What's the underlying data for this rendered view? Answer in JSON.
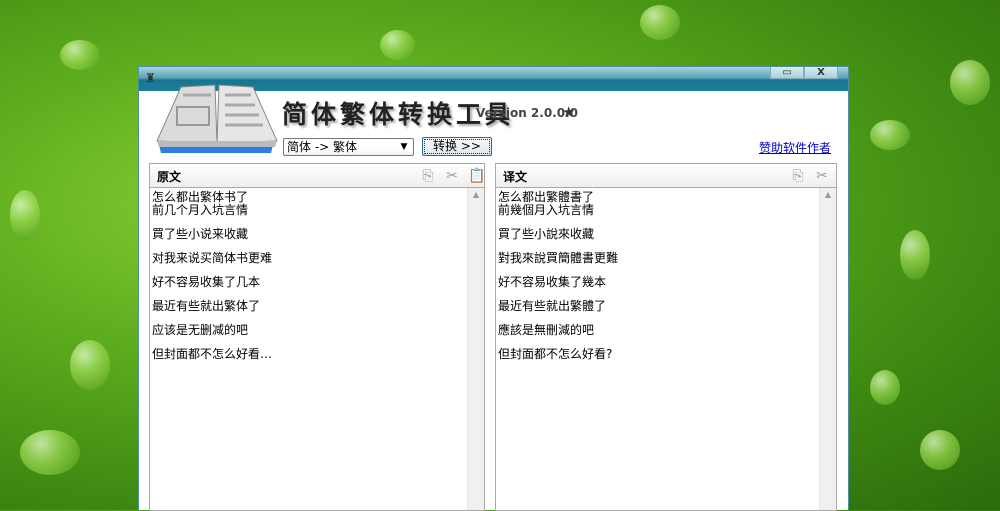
{
  "window": {
    "app_title": "简体繁体转换工具",
    "version": "Version 2.0.0.0",
    "minimize": "▭",
    "close": "X"
  },
  "toolbar": {
    "direction_selected": "简体 -> 繁体",
    "convert_label": "转换 >>",
    "sponsor_link": "赞助软件作者"
  },
  "source": {
    "label": "原文",
    "lines": [
      "怎么都出繁体书了",
      "前几个月入坑言情",
      "買了些小说来收藏",
      "对我来说买简体书更难",
      "好不容易收集了几本",
      "最近有些就出繁体了",
      "应该是无删减的吧",
      "但封面都不怎么好看…"
    ]
  },
  "target": {
    "label": "译文",
    "lines": [
      "怎么都出繁體書了",
      "前幾個月入坑言情",
      "買了些小說來收藏",
      "對我來說買簡體書更難",
      "好不容易收集了幾本",
      "最近有些就出繁體了",
      "應該是無刪減的吧",
      "但封面都不怎么好看?"
    ]
  }
}
